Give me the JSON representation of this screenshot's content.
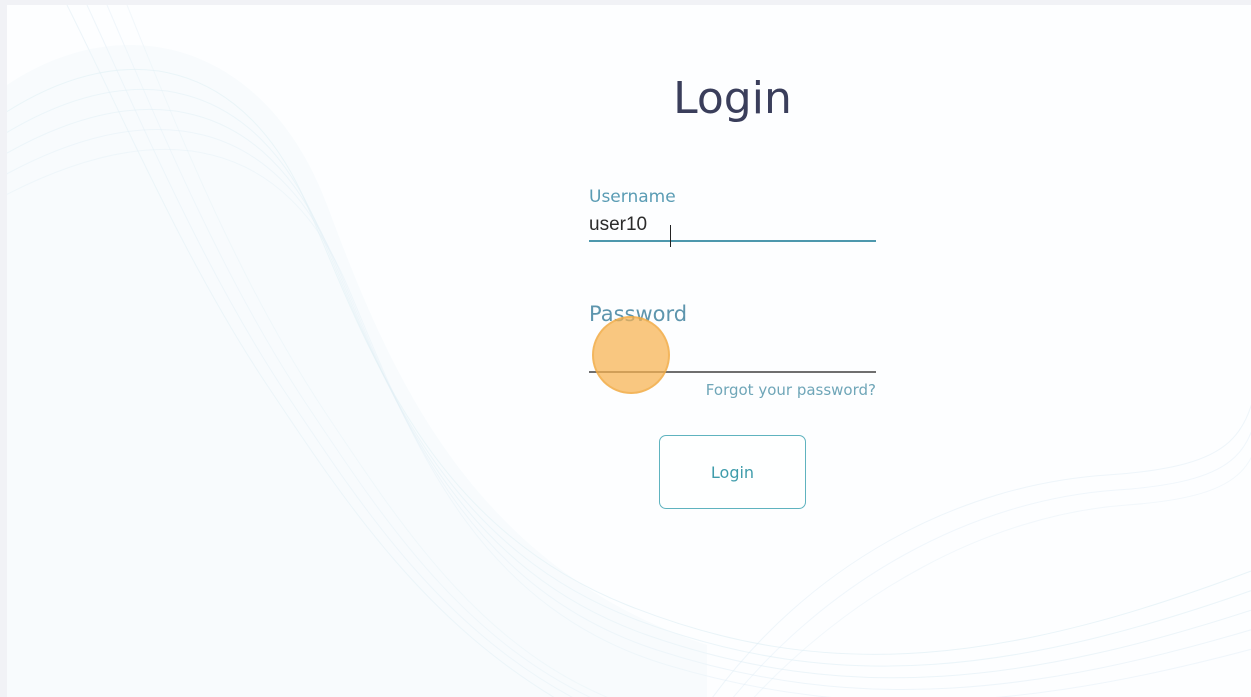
{
  "page": {
    "title": "Login"
  },
  "form": {
    "username": {
      "label": "Username",
      "value": "user10"
    },
    "password": {
      "label": "Password",
      "value": ""
    },
    "forgot_link": "Forgot your password?",
    "submit_label": "Login"
  },
  "colors": {
    "title": "#3a3e5b",
    "label": "#5a9cb4",
    "accent": "#4d98ad",
    "button_border": "#5fb3bf",
    "click_marker": "#f6b14f"
  }
}
